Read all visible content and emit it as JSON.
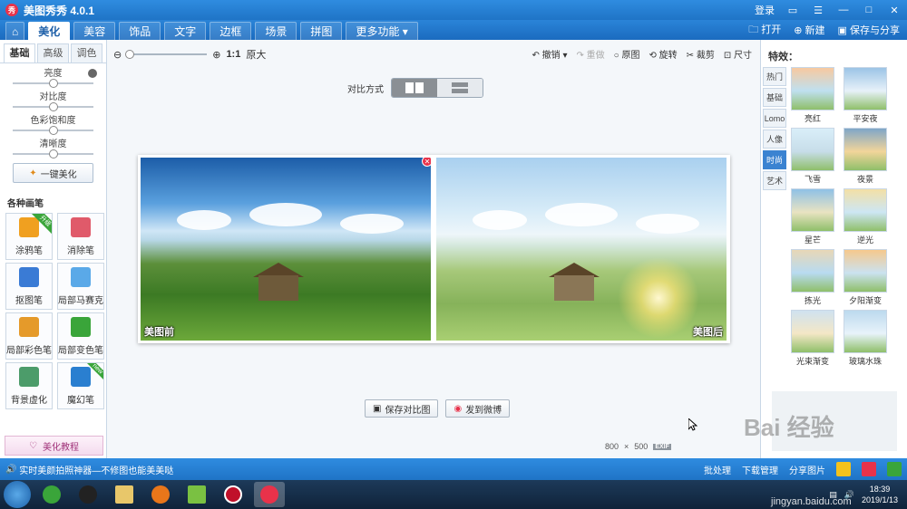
{
  "titlebar": {
    "title": "美图秀秀 4.0.1",
    "login": "登录",
    "logo": "秀"
  },
  "tabs": [
    {
      "label": "美化",
      "active": true
    },
    {
      "label": "美容"
    },
    {
      "label": "饰品"
    },
    {
      "label": "文字"
    },
    {
      "label": "边框"
    },
    {
      "label": "场景"
    },
    {
      "label": "拼图"
    },
    {
      "label": "更多功能 ▾"
    }
  ],
  "toolbar_right": {
    "open": "打开",
    "new": "新建",
    "save_share": "保存与分享"
  },
  "left": {
    "subtabs": [
      "基础",
      "高级",
      "调色"
    ],
    "sliders": [
      {
        "label": "亮度",
        "value": 0.5
      },
      {
        "label": "对比度",
        "value": 0.5
      },
      {
        "label": "色彩饱和度",
        "value": 0.5
      },
      {
        "label": "清晰度",
        "value": 0.5
      }
    ],
    "one_key": "一键美化",
    "brush_title": "各种画笔",
    "brushes": [
      {
        "label": "涂鸦笔",
        "badge": "升级",
        "color": "#f0a020"
      },
      {
        "label": "消除笔",
        "color": "#e05a6a"
      },
      {
        "label": "抠图笔",
        "color": "#3a7bd5"
      },
      {
        "label": "局部马赛克",
        "color": "#5aa9e8"
      },
      {
        "label": "局部彩色笔",
        "color": "#e59a2a"
      },
      {
        "label": "局部变色笔",
        "color": "#3aa53a"
      },
      {
        "label": "背景虚化",
        "color": "#4c9c6a"
      },
      {
        "label": "魔幻笔",
        "badge": "new",
        "color": "#2a7fd0"
      }
    ],
    "tutorial": "美化教程"
  },
  "center": {
    "zoom_ratio": "1:1",
    "zoom_original": "原大",
    "actions": [
      {
        "label": "撤销 ▾"
      },
      {
        "label": "重做",
        "dim": true
      },
      {
        "label": "原图"
      },
      {
        "label": "旋转"
      },
      {
        "label": "裁剪"
      },
      {
        "label": "尺寸"
      }
    ],
    "compare_label": "对比方式",
    "before_label": "美图前",
    "after_label": "美图后",
    "save_compare": "保存对比图",
    "send_weibo": "发到微博",
    "img_w": "800",
    "img_x": "×",
    "img_h": "500",
    "exif": "EXIF"
  },
  "right": {
    "title": "特效：",
    "tabs": [
      {
        "label": "热门"
      },
      {
        "label": "基础"
      },
      {
        "label": "Lomo"
      },
      {
        "label": "人像"
      },
      {
        "label": "时尚",
        "active": true
      },
      {
        "label": "艺术"
      }
    ],
    "effects": [
      "亮红",
      "平安夜",
      "飞雪",
      "夜景",
      "星芒",
      "逆光",
      "拣光",
      "夕阳渐变",
      "光束渐变",
      "玻璃水珠"
    ]
  },
  "status": {
    "tip": "实时美颜拍照神器—不修图也能美美哒",
    "batch": "批处理",
    "download": "下载管理",
    "share": "分享图片"
  },
  "taskbar": {
    "time": "18:39",
    "date": "2019/1/13"
  },
  "watermark": {
    "logo": "Bai 经验",
    "url": "jingyan.baidu.com"
  },
  "colors": {
    "titlebar": "#2a84d8",
    "accent": "#3b83d1",
    "close": "#e8324a"
  }
}
